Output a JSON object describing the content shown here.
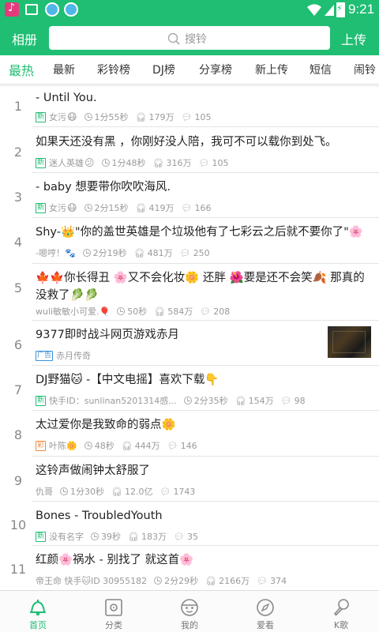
{
  "status_bar": {
    "time": "9:21",
    "icons": [
      "music-app-icon",
      "image-app-icon",
      "browser-app-icon",
      "browser-app-icon",
      "wifi-icon",
      "signal-icon",
      "battery-charging-icon"
    ]
  },
  "header": {
    "left_label": "相册",
    "search_placeholder": "搜铃",
    "right_label": "上传"
  },
  "tabs": [
    "最热",
    "最新",
    "彩铃榜",
    "DJ榜",
    "分享榜",
    "新上传",
    "短信",
    "闹铃"
  ],
  "active_tab": "最热",
  "colors": {
    "accent": "#1fbe73",
    "text": "#222222",
    "meta": "#9a9a9a"
  },
  "rows": [
    {
      "num": "1",
      "title": "- Until You.",
      "badge": "新",
      "user": "女污",
      "duration": "1分55秒",
      "plays": "179万",
      "comments": "105"
    },
    {
      "num": "2",
      "title": "如果天还没有黑 ，你刚好没人陪，我可不可以载你到处飞。",
      "badge": "新",
      "user": "迷人英雄",
      "duration": "1分48秒",
      "plays": "316万",
      "comments": "105"
    },
    {
      "num": "3",
      "title": "- baby 想要带你吹吹海风.",
      "badge": "新",
      "user": "女污",
      "duration": "2分15秒",
      "plays": "419万",
      "comments": "166"
    },
    {
      "num": "4",
      "title": "Shy-👑\"你的盖世英雄是个垃圾他有了七彩云之后就不要你了\"🌸",
      "badge": "",
      "user": "-嗯哼！🐾",
      "duration": "2分19秒",
      "plays": "481万",
      "comments": "250"
    },
    {
      "num": "5",
      "title": "🍁🍁你长得丑 🌸又不会化妆🌼 还胖 🌺要是还不会笑🍂 那真的没救了🥬🥬",
      "badge": "",
      "user": "wuli敏敏小可爱.🎈",
      "duration": "50秒",
      "plays": "584万",
      "comments": "208"
    },
    {
      "num": "6",
      "title": "9377即时战斗网页游戏赤月",
      "badge": "广告",
      "user": "赤月传奇",
      "duration": "",
      "plays": "",
      "comments": ""
    },
    {
      "num": "7",
      "title": "DJ野猫🐱 -【中文电摇】喜欢下载👇",
      "badge": "新",
      "user": "快手ID：sunlinan5201314感...",
      "duration": "2分35秒",
      "plays": "154万",
      "comments": "98"
    },
    {
      "num": "8",
      "title": "太过爱你是我致命的弱点🌼",
      "badge": "彩",
      "user": "叶陈🌼",
      "duration": "48秒",
      "plays": "444万",
      "comments": "146"
    },
    {
      "num": "9",
      "title": "这铃声做闹钟太舒服了",
      "badge": "",
      "user": "仇哥",
      "duration": "1分30秒",
      "plays": "12.0亿",
      "comments": "1743"
    },
    {
      "num": "10",
      "title": "Bones - TroubledYouth",
      "badge": "新",
      "user": "没有名字",
      "duration": "39秒",
      "plays": "183万",
      "comments": "35"
    },
    {
      "num": "11",
      "title": "红颜🌸祸水 - 别找了 就这首🌸",
      "badge": "",
      "user": "帝王命 快手🐱ID 30955182",
      "duration": "2分29秒",
      "plays": "2166万",
      "comments": "374"
    }
  ],
  "bottom_nav": [
    {
      "label": "首页",
      "icon": "home-bell-icon"
    },
    {
      "label": "分类",
      "icon": "category-music-icon"
    },
    {
      "label": "我的",
      "icon": "profile-face-icon"
    },
    {
      "label": "爱看",
      "icon": "compass-icon"
    },
    {
      "label": "K歌",
      "icon": "microphone-icon"
    }
  ]
}
